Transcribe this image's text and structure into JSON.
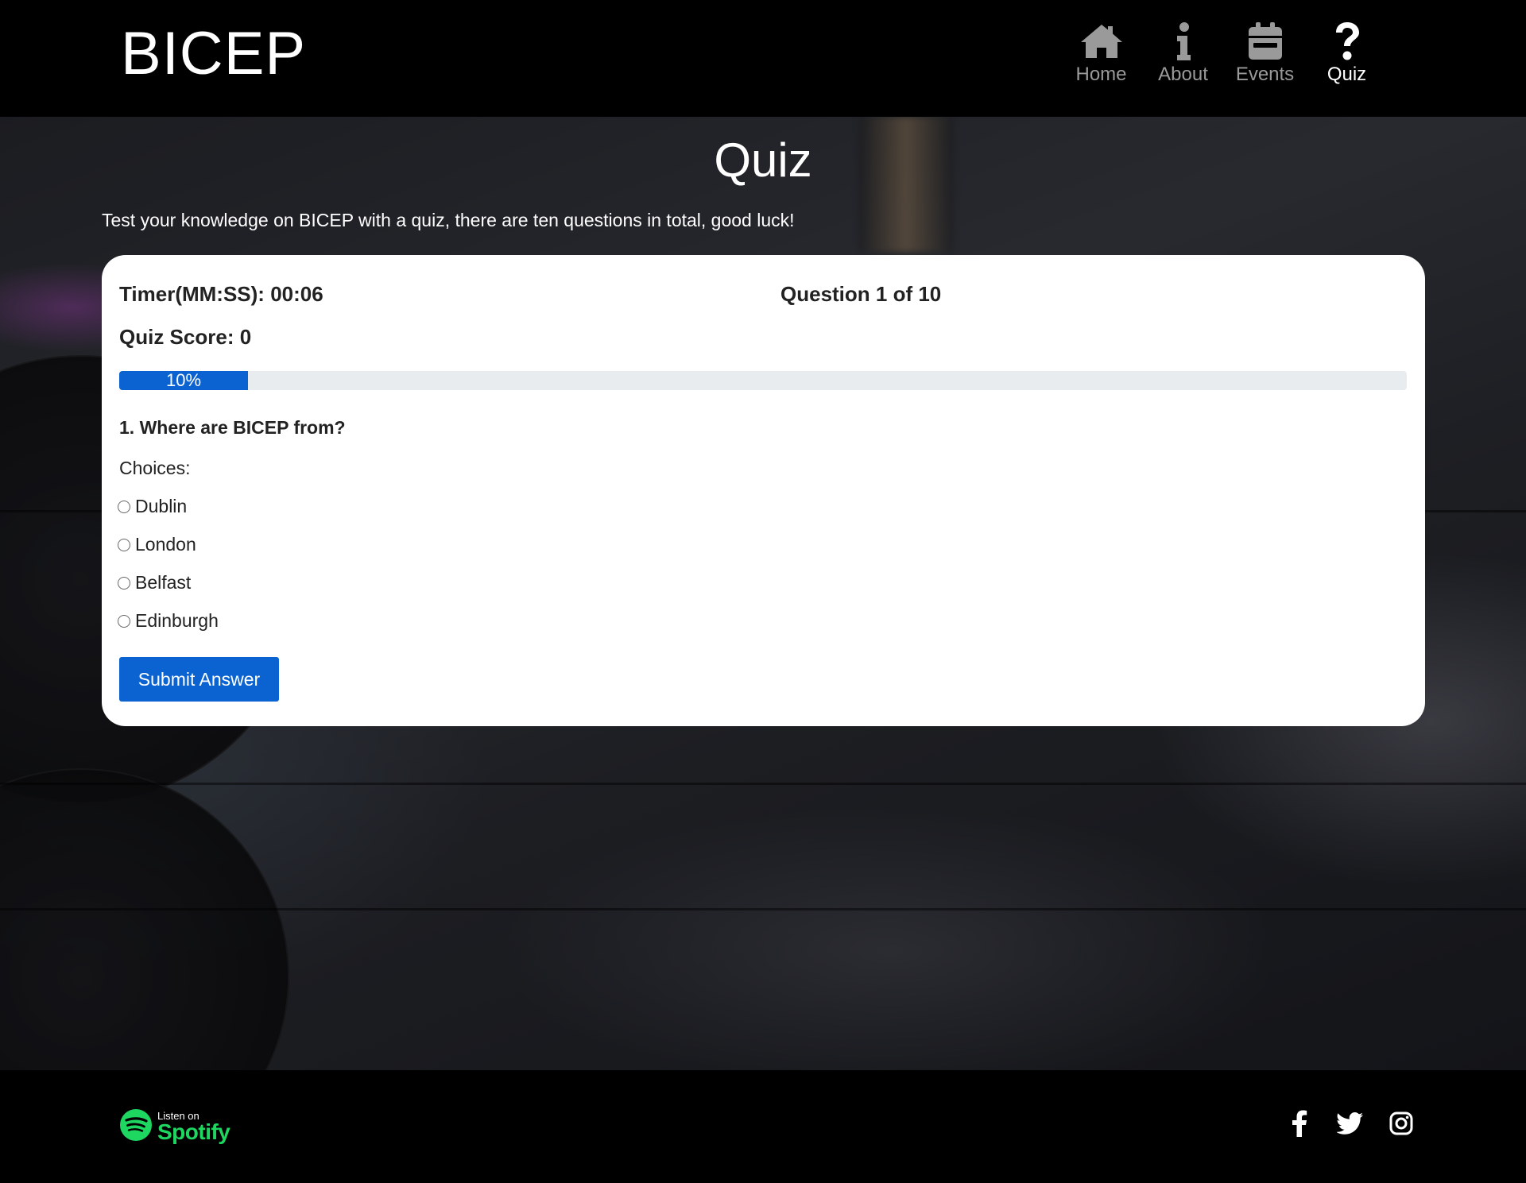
{
  "header": {
    "brand": "BICEP",
    "nav": [
      {
        "label": "Home",
        "icon": "home-icon"
      },
      {
        "label": "About",
        "icon": "info-icon"
      },
      {
        "label": "Events",
        "icon": "calendar-icon"
      },
      {
        "label": "Quiz",
        "icon": "question-icon",
        "active": true
      }
    ]
  },
  "main": {
    "title": "Quiz",
    "intro": "Test your knowledge on BICEP with a quiz, there are ten questions in total, good luck!"
  },
  "quiz": {
    "timer": "Timer(MM:SS): 00:06",
    "question_count": "Question 1 of 10",
    "score": "Quiz Score: 0",
    "progress_label": "10%",
    "progress_fraction": 0.1,
    "question": "1. Where are BICEP from?",
    "choices_label": "Choices:",
    "choices": [
      "Dublin",
      "London",
      "Belfast",
      "Edinburgh"
    ],
    "submit_label": "Submit Answer"
  },
  "footer": {
    "spotify_small": "Listen on",
    "spotify_big": "Spotify",
    "socials": [
      "facebook-icon",
      "twitter-icon",
      "instagram-icon"
    ]
  },
  "colors": {
    "accent": "#0b63d1",
    "spotify_green": "#1ed760",
    "nav_inactive": "#9a9a9a"
  }
}
